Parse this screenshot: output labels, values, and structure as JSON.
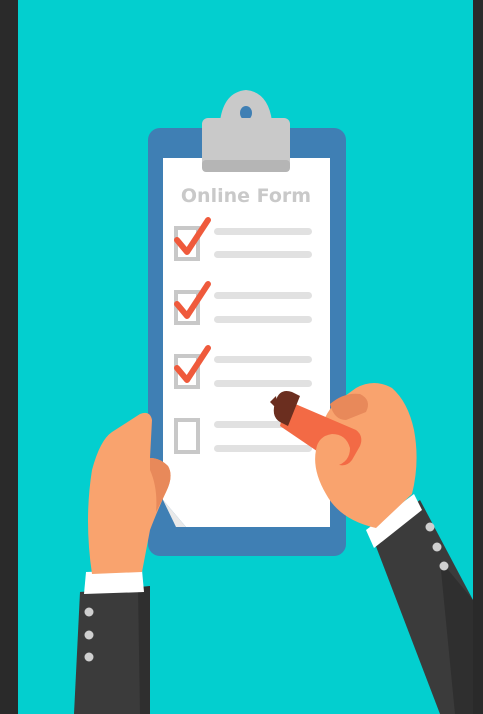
{
  "illustration": {
    "form_title": "Online Form",
    "checklist": [
      {
        "checked": true
      },
      {
        "checked": true
      },
      {
        "checked": true
      },
      {
        "checked": false
      }
    ]
  },
  "colors": {
    "frame": "#2a2a2a",
    "background": "#03cfcf",
    "board": "#3f7fb4",
    "board_shadow": "#3673a6",
    "paper": "#ffffff",
    "paper_fold": "#e9e9e9",
    "clip": "#c9c9c9",
    "clip_dark": "#a9a9a9",
    "checkbox": "#c8c8c8",
    "checkmark": "#ef5a3c",
    "lines": "#e1e1e1",
    "title_text": "#c9c9c9",
    "skin": "#f9a36e",
    "skin_shadow": "#e8895a",
    "sleeve": "#3b3b3b",
    "sleeve_dark": "#2f2f2f",
    "cuff": "#ffffff",
    "cuff_button": "#cfcfcf",
    "marker_body": "#f36a45",
    "marker_tip": "#6b2e1f"
  }
}
